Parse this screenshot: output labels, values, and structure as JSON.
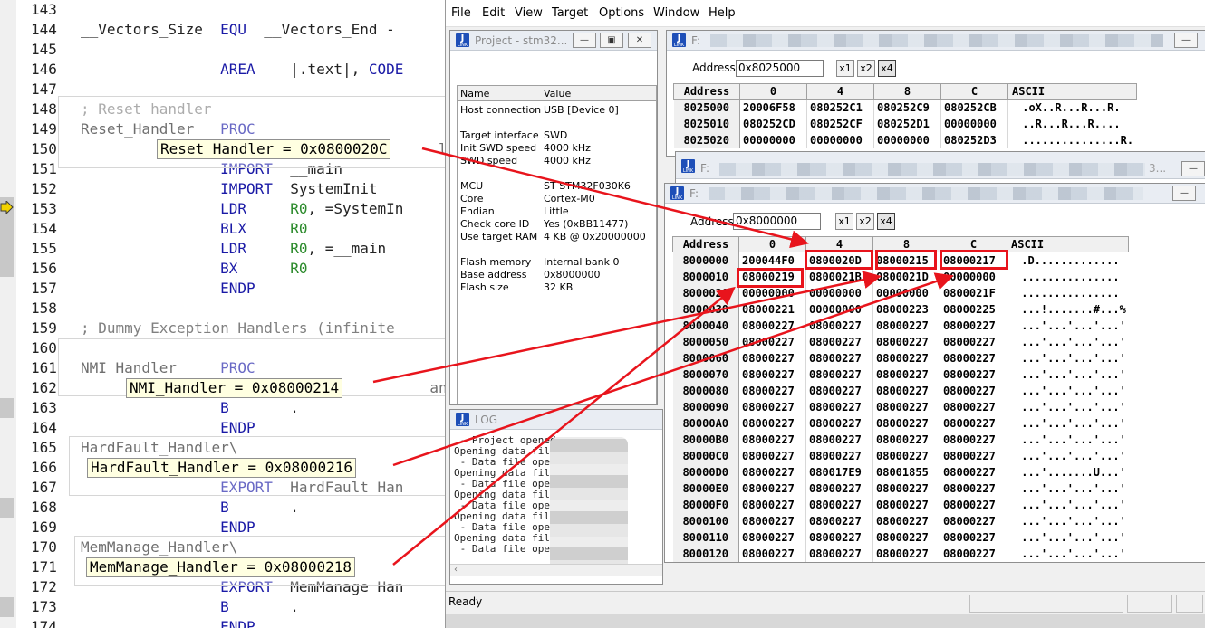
{
  "editor": {
    "lines": [
      {
        "n": "143",
        "code": [
          {
            "t": "",
            "c": "pl"
          }
        ]
      },
      {
        "n": "144",
        "code": [
          {
            "t": "__Vectors_Size  ",
            "c": "pl"
          },
          {
            "t": "EQU",
            "c": "kw"
          },
          {
            "t": "  __Vectors_End - ",
            "c": "pl"
          }
        ]
      },
      {
        "n": "145",
        "code": [
          {
            "t": "",
            "c": "pl"
          }
        ]
      },
      {
        "n": "146",
        "code": [
          {
            "t": "                ",
            "c": "pl"
          },
          {
            "t": "AREA",
            "c": "kw"
          },
          {
            "t": "    |.text|, ",
            "c": "pl"
          },
          {
            "t": "CODE",
            "c": "kw"
          }
        ]
      },
      {
        "n": "147",
        "code": [
          {
            "t": "",
            "c": "pl"
          }
        ]
      },
      {
        "n": "148",
        "code": [
          {
            "t": "; Reset handler",
            "c": "cm"
          }
        ]
      },
      {
        "n": "149",
        "code": [
          {
            "t": "Reset_Handler   ",
            "c": "pl"
          },
          {
            "t": "PROC",
            "c": "kw"
          }
        ]
      },
      {
        "n": "150",
        "code": [
          {
            "t": "                                         ler",
            "c": "pl"
          }
        ]
      },
      {
        "n": "151",
        "code": [
          {
            "t": "                ",
            "c": "pl"
          },
          {
            "t": "IMPORT",
            "c": "kw"
          },
          {
            "t": "  __main",
            "c": "pl"
          }
        ]
      },
      {
        "n": "152",
        "code": [
          {
            "t": "                ",
            "c": "pl"
          },
          {
            "t": "IMPORT",
            "c": "kw"
          },
          {
            "t": "  SystemInit",
            "c": "pl"
          }
        ]
      },
      {
        "n": "153",
        "code": [
          {
            "t": "                ",
            "c": "pl"
          },
          {
            "t": "LDR",
            "c": "kw"
          },
          {
            "t": "     ",
            "c": "pl"
          },
          {
            "t": "R0",
            "c": "gr"
          },
          {
            "t": ", =SystemIn",
            "c": "pl"
          }
        ]
      },
      {
        "n": "154",
        "code": [
          {
            "t": "                ",
            "c": "pl"
          },
          {
            "t": "BLX",
            "c": "kw"
          },
          {
            "t": "     ",
            "c": "pl"
          },
          {
            "t": "R0",
            "c": "gr"
          }
        ]
      },
      {
        "n": "155",
        "code": [
          {
            "t": "                ",
            "c": "pl"
          },
          {
            "t": "LDR",
            "c": "kw"
          },
          {
            "t": "     ",
            "c": "pl"
          },
          {
            "t": "R0",
            "c": "gr"
          },
          {
            "t": ", =__main",
            "c": "pl"
          }
        ]
      },
      {
        "n": "156",
        "code": [
          {
            "t": "                ",
            "c": "pl"
          },
          {
            "t": "BX",
            "c": "kw"
          },
          {
            "t": "      ",
            "c": "pl"
          },
          {
            "t": "R0",
            "c": "gr"
          }
        ]
      },
      {
        "n": "157",
        "code": [
          {
            "t": "                ",
            "c": "pl"
          },
          {
            "t": "ENDP",
            "c": "kw"
          }
        ]
      },
      {
        "n": "158",
        "code": [
          {
            "t": "",
            "c": "pl"
          }
        ]
      },
      {
        "n": "159",
        "code": [
          {
            "t": "; Dummy Exception Handlers (infinite ",
            "c": "cm"
          }
        ]
      },
      {
        "n": "160",
        "code": [
          {
            "t": "",
            "c": "pl"
          }
        ]
      },
      {
        "n": "161",
        "code": [
          {
            "t": "NMI_Handler     ",
            "c": "pl"
          },
          {
            "t": "PROC",
            "c": "kw"
          }
        ]
      },
      {
        "n": "162",
        "code": [
          {
            "t": "                                        andler",
            "c": "pl"
          }
        ]
      },
      {
        "n": "163",
        "code": [
          {
            "t": "                ",
            "c": "pl"
          },
          {
            "t": "B",
            "c": "kw"
          },
          {
            "t": "       .",
            "c": "pl"
          }
        ]
      },
      {
        "n": "164",
        "code": [
          {
            "t": "                ",
            "c": "pl"
          },
          {
            "t": "ENDP",
            "c": "kw"
          }
        ]
      },
      {
        "n": "165",
        "code": [
          {
            "t": "HardFault_Handler\\",
            "c": "pl"
          }
        ]
      },
      {
        "n": "166",
        "code": [
          {
            "t": "",
            "c": "pl"
          }
        ]
      },
      {
        "n": "167",
        "code": [
          {
            "t": "                ",
            "c": "pl"
          },
          {
            "t": "EXPORT",
            "c": "kw"
          },
          {
            "t": "  HardFault_Han",
            "c": "pl"
          }
        ]
      },
      {
        "n": "168",
        "code": [
          {
            "t": "                ",
            "c": "pl"
          },
          {
            "t": "B",
            "c": "kw"
          },
          {
            "t": "       .",
            "c": "pl"
          }
        ]
      },
      {
        "n": "169",
        "code": [
          {
            "t": "                ",
            "c": "pl"
          },
          {
            "t": "ENDP",
            "c": "kw"
          }
        ]
      },
      {
        "n": "170",
        "code": [
          {
            "t": "MemManage_Handler\\",
            "c": "pl"
          }
        ]
      },
      {
        "n": "171",
        "code": [
          {
            "t": "",
            "c": "pl"
          }
        ]
      },
      {
        "n": "172",
        "code": [
          {
            "t": "                ",
            "c": "pl"
          },
          {
            "t": "EXPORT",
            "c": "kw"
          },
          {
            "t": "  MemManage_Han",
            "c": "pl"
          }
        ]
      },
      {
        "n": "173",
        "code": [
          {
            "t": "                ",
            "c": "pl"
          },
          {
            "t": "B",
            "c": "kw"
          },
          {
            "t": "       .",
            "c": "pl"
          }
        ]
      },
      {
        "n": "174",
        "code": [
          {
            "t": "                ",
            "c": "pl"
          },
          {
            "t": "ENDP",
            "c": "kw"
          }
        ]
      }
    ],
    "hints": {
      "reset": "Reset_Handler = 0x0800020C",
      "nmi": "NMI_Handler = 0x08000214",
      "hardfault": "HardFault_Handler = 0x08000216",
      "memmanage": "MemManage_Handler = 0x08000218"
    }
  },
  "app": {
    "menu": [
      "File",
      "Edit",
      "View",
      "Target",
      "Options",
      "Window",
      "Help"
    ],
    "status": "Ready",
    "project": {
      "title": "Project - stm32...",
      "col_name": "Name",
      "col_value": "Value",
      "rows": [
        {
          "k": "Host connection",
          "v": "USB [Device 0]"
        },
        {
          "k": "",
          "v": ""
        },
        {
          "k": "Target interface",
          "v": "SWD"
        },
        {
          "k": "Init SWD speed",
          "v": "4000 kHz"
        },
        {
          "k": "SWD speed",
          "v": "4000 kHz"
        },
        {
          "k": "",
          "v": ""
        },
        {
          "k": "MCU",
          "v": "ST STM32F030K6"
        },
        {
          "k": "Core",
          "v": "Cortex-M0"
        },
        {
          "k": "Endian",
          "v": "Little"
        },
        {
          "k": "Check core ID",
          "v": "Yes (0xBB11477)"
        },
        {
          "k": "Use target RAM",
          "v": "4 KB @ 0x20000000"
        },
        {
          "k": "",
          "v": ""
        },
        {
          "k": "Flash memory",
          "v": "Internal bank 0"
        },
        {
          "k": "Base address",
          "v": "0x8000000"
        },
        {
          "k": "Flash size",
          "v": "32 KB"
        }
      ]
    },
    "log": {
      "title": "LOG",
      "lines": [
        " - Project opened su",
        "Opening data file [F",
        " - Data file opened",
        "Opening data file [",
        " - Data file opened",
        "Opening data file",
        " - Data file opene",
        "Opening data file",
        " - Data file opene",
        "Opening data file [",
        " - Data file opened"
      ]
    },
    "mem1": {
      "title": "F:",
      "address_label": "Address:",
      "address": "0x8025000",
      "x1": "x1",
      "x2": "x2",
      "x4": "x4",
      "headers": [
        "Address",
        "0",
        "4",
        "8",
        "C",
        "ASCII"
      ],
      "rows": [
        [
          "8025000",
          "20006F58",
          "080252C1",
          "080252C9",
          "080252CB",
          " .oX..R...R...R."
        ],
        [
          "8025010",
          "080252CD",
          "080252CF",
          "080252D1",
          "00000000",
          " ..R...R...R...."
        ],
        [
          "8025020",
          "00000000",
          "00000000",
          "00000000",
          "080252D3",
          " ...............R."
        ]
      ]
    },
    "mem2": {
      "title": "F:",
      "title_tail": "3...",
      "btn_min": "—"
    },
    "mem3": {
      "title": "F:",
      "address_label": "Address:",
      "address": "0x8000000",
      "x1": "x1",
      "x2": "x2",
      "x4": "x4",
      "headers": [
        "Address",
        "0",
        "4",
        "8",
        "C",
        "ASCII"
      ],
      "rows": [
        [
          "8000000",
          "200044F0",
          "0800020D",
          "08000215",
          "08000217",
          " .D............."
        ],
        [
          "8000010",
          "08000219",
          "0800021B",
          "0800021D",
          "00000000",
          " ..............."
        ],
        [
          "8000020",
          "00000000",
          "00000000",
          "00000000",
          "0800021F",
          " ..............."
        ],
        [
          "8000030",
          "08000221",
          "00000000",
          "08000223",
          "08000225",
          " ...!.......#...%"
        ],
        [
          "8000040",
          "08000227",
          "08000227",
          "08000227",
          "08000227",
          " ...'...'...'...'"
        ],
        [
          "8000050",
          "08000227",
          "08000227",
          "08000227",
          "08000227",
          " ...'...'...'...'"
        ],
        [
          "8000060",
          "08000227",
          "08000227",
          "08000227",
          "08000227",
          " ...'...'...'...'"
        ],
        [
          "8000070",
          "08000227",
          "08000227",
          "08000227",
          "08000227",
          " ...'...'...'...'"
        ],
        [
          "8000080",
          "08000227",
          "08000227",
          "08000227",
          "08000227",
          " ...'...'...'...'"
        ],
        [
          "8000090",
          "08000227",
          "08000227",
          "08000227",
          "08000227",
          " ...'...'...'...'"
        ],
        [
          "80000A0",
          "08000227",
          "08000227",
          "08000227",
          "08000227",
          " ...'...'...'...'"
        ],
        [
          "80000B0",
          "08000227",
          "08000227",
          "08000227",
          "08000227",
          " ...'...'...'...'"
        ],
        [
          "80000C0",
          "08000227",
          "08000227",
          "08000227",
          "08000227",
          " ...'...'...'...'"
        ],
        [
          "80000D0",
          "08000227",
          "080017E9",
          "08001855",
          "08000227",
          " ...'.......U...'"
        ],
        [
          "80000E0",
          "08000227",
          "08000227",
          "08000227",
          "08000227",
          " ...'...'...'...'"
        ],
        [
          "80000F0",
          "08000227",
          "08000227",
          "08000227",
          "08000227",
          " ...'...'...'...'"
        ],
        [
          "8000100",
          "08000227",
          "08000227",
          "08000227",
          "08000227",
          " ...'...'...'...'"
        ],
        [
          "8000110",
          "08000227",
          "08000227",
          "08000227",
          "08000227",
          " ...'...'...'...'"
        ],
        [
          "8000120",
          "08000227",
          "08000227",
          "08000227",
          "08000227",
          " ...'...'...'...'"
        ]
      ]
    }
  },
  "colors": {
    "annotation": "#e8141c",
    "keyword": "#1a1aa6",
    "comment": "#808080",
    "register": "#2b8a2b"
  }
}
